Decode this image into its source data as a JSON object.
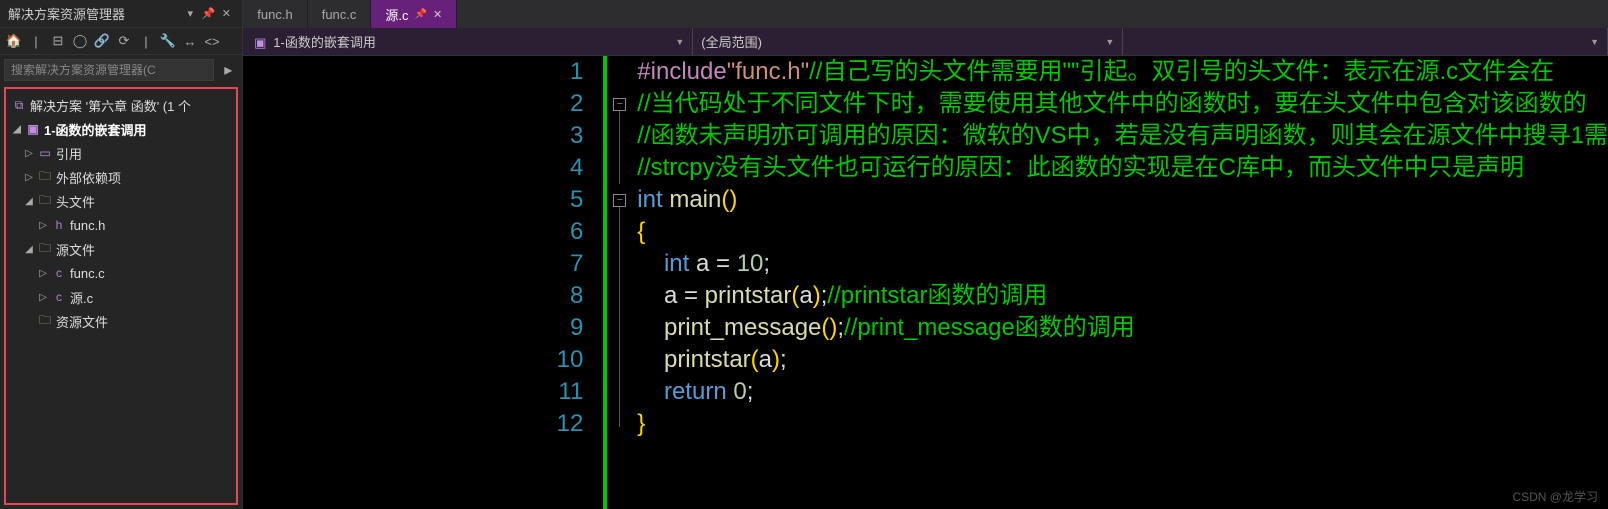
{
  "sidebar": {
    "title": "解决方案资源管理器",
    "search_placeholder": "搜索解决方案资源管理器(C",
    "solution_label": "解决方案 '第六章 函数' (1 个",
    "project_label": "1-函数的嵌套调用",
    "refs_label": "引用",
    "external_label": "外部依赖项",
    "headers_label": "头文件",
    "func_h": "func.h",
    "sources_label": "源文件",
    "func_c": "func.c",
    "source_c": "源.c",
    "resources_label": "资源文件"
  },
  "tabs": {
    "t1": "func.h",
    "t2": "func.c",
    "t3": "源.c"
  },
  "nav": {
    "left": "1-函数的嵌套调用",
    "right": "(全局范围)"
  },
  "code": {
    "l1a": "#include",
    "l1b": "\"func.h\"",
    "l1c": "//自己写的头文件需要用\"\"引起。双引号的头文件：表示在源.c文件会在",
    "l2": "//当代码处于不同文件下时，需要使用其他文件中的函数时，要在头文件中包含对该函数的",
    "l3": "//函数未声明亦可调用的原因：微软的VS中，若是没有声明函数，则其会在源文件中搜寻1需",
    "l4": "//strcpy没有头文件也可运行的原因：此函数的实现是在C库中，而头文件中只是声明",
    "l5a": "int",
    "l5b": " main",
    "l5c": "()",
    "l6": "{",
    "l7a": "    ",
    "l7b": "int",
    "l7c": " a ",
    "l7d": "=",
    "l7e": " ",
    "l7f": "10",
    "l7g": ";",
    "l8a": "    a ",
    "l8b": "=",
    "l8c": " printstar",
    "l8d": "(",
    "l8e": "a",
    "l8f": ")",
    "l8g": ";",
    "l8h": "//printstar函数的调用",
    "l9a": "    print_message",
    "l9b": "()",
    "l9c": ";",
    "l9d": "//print_message函数的调用",
    "l10a": "    printstar",
    "l10b": "(",
    "l10c": "a",
    "l10d": ")",
    "l10e": ";",
    "l11a": "    ",
    "l11b": "return",
    "l11c": " ",
    "l11d": "0",
    "l11e": ";",
    "l12": "}"
  },
  "line_numbers": [
    "1",
    "2",
    "3",
    "4",
    "5",
    "6",
    "7",
    "8",
    "9",
    "10",
    "11",
    "12"
  ],
  "watermark": "CSDN @龙学习"
}
